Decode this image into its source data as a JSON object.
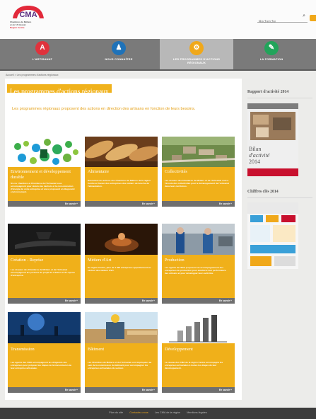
{
  "header": {
    "logo_lines": [
      "Chambres de Métiers",
      "et de l'Artisanat",
      "Région Centre"
    ],
    "search_placeholder": "Recherche"
  },
  "nav": [
    {
      "label": "L'ARTISANAT",
      "color": "#e0323c",
      "icon": "artisanat-icon"
    },
    {
      "label": "NOUS CONNAÎTRE",
      "color": "#1f72b8",
      "icon": "people-icon"
    },
    {
      "label": "LES PROGRAMMES D'ACTIONS RÉGIONAUX",
      "color": "#f0a81a",
      "icon": "programmes-icon",
      "active": true
    },
    {
      "label": "LA FORMATION",
      "color": "#22a45a",
      "icon": "formation-icon"
    }
  ],
  "breadcrumb": "Accueil > Les programmes d'actions régionaux",
  "main": {
    "title": "Les programmes d'actions régionaux",
    "intro": "Les programmes régionaux proposent des actions en direction des artisans en fonction de leurs besoins."
  },
  "cards": [
    {
      "title": "Environnement et développement durable",
      "desc": "Si vos chambres et Chambres de l'Artisanat vous accompagnent pour réduire les déchets et la consommation d'énergie de votre entreprise et vous proposent un diagnostic environnement.",
      "more": "En savoir +"
    },
    {
      "title": "Alimentaire",
      "desc": "Découvrez les actions des Chambres de Métiers de la région Centre en faveur des entreprises des métiers de bouche de l'alimentation.",
      "more": "En savoir +"
    },
    {
      "title": "Collectivités",
      "desc": "Les réseaux des Chambres de Métiers et de l'Artisanat sont à l'écoute des collectivités pour le développement de l'artisanat dans leurs territoires.",
      "more": "En savoir +"
    },
    {
      "title": "Création - Reprise",
      "desc": "Les réseaux des Chambres de Métiers et de l'Artisanat accompagnent les porteurs de projet de création et de reprise d'entreprise.",
      "more": "En savoir +"
    },
    {
      "title": "Métiers d'Art",
      "desc": "En région Centre, plus de 1 000 entreprises appartiennent au secteur des métiers d'art.",
      "more": "En savoir +"
    },
    {
      "title": "Production",
      "desc": "Les agents de l'Etat proposent un accompagnement aux entreprises de production pour améliorer leur performance des artisans et pour développer leurs activités.",
      "more": "En savoir +"
    },
    {
      "title": "Transmission",
      "desc": "Les agents des CMA accompagnent les dirigeants des entreprises pour préparer les étapes de la transmission de leur entreprise artisanale.",
      "more": "En savoir +"
    },
    {
      "title": "Bâtiment",
      "desc": "Les Chambres de Métiers et de l'Artisanat sont impliquées au sein de la commission du bâtiment pour accompagner les entreprises artisanales du secteur.",
      "more": "En savoir +"
    },
    {
      "title": "Développement",
      "desc": "Le réseau des CMA de la région Centre accompagne les entreprises artisanales à toutes les étapes de leur développement.",
      "more": "En savoir +"
    }
  ],
  "sidebar": {
    "report_title": "Rapport d'activité 2014",
    "report_cover_text": [
      "Bilan",
      "d'activité",
      "2014"
    ],
    "figures_title": "Chiffres clés 2014"
  },
  "footer": {
    "links": [
      "Plan du site",
      "Contactez-nous",
      "Les CMA de la région",
      "Mentions légales"
    ]
  },
  "colors": {
    "accent": "#f0b01a",
    "nav_bg": "#7a7a7a",
    "footer_bg": "#3c3c3c"
  }
}
